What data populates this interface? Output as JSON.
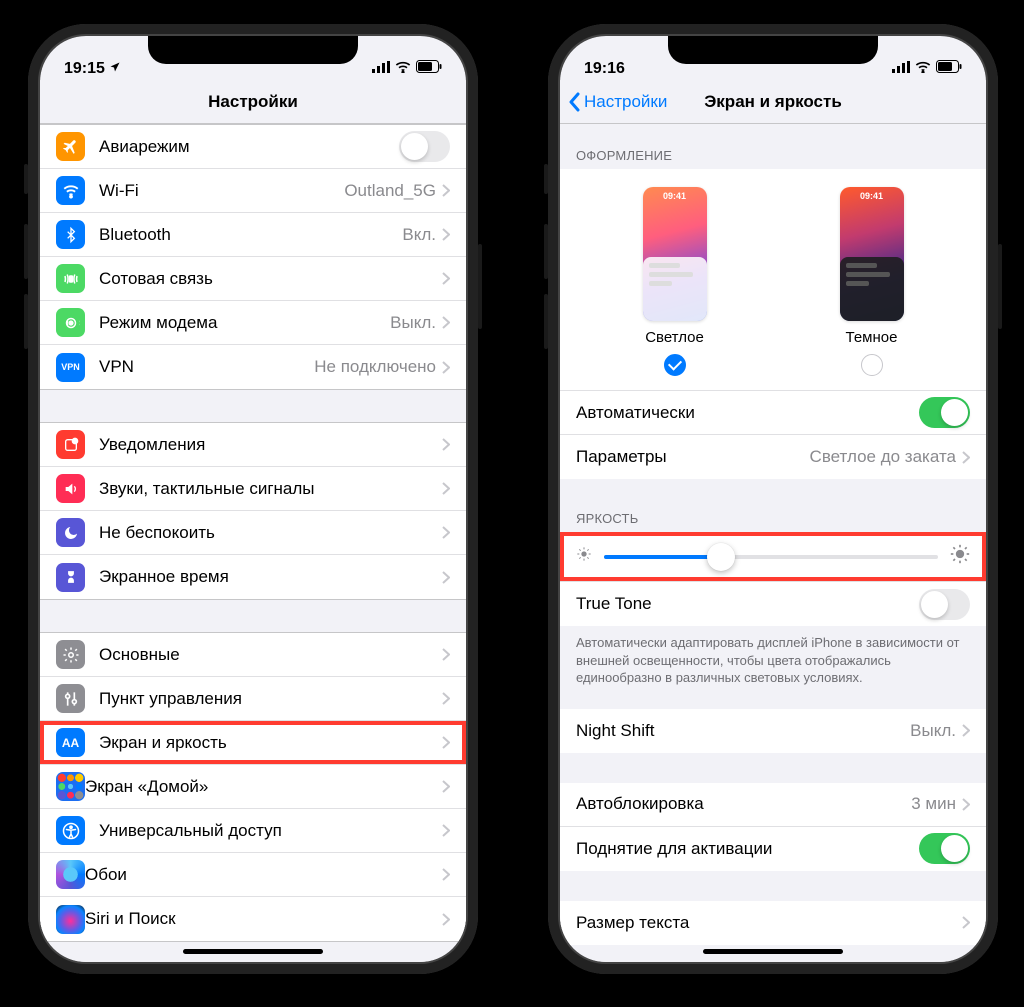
{
  "left": {
    "time": "19:15",
    "title": "Настройки",
    "groups": [
      [
        {
          "name": "airplane",
          "label": "Авиарежим",
          "icon_bg": "#ff9500",
          "toggle": false
        },
        {
          "name": "wifi",
          "label": "Wi-Fi",
          "value": "Outland_5G",
          "icon_bg": "#007aff"
        },
        {
          "name": "bluetooth",
          "label": "Bluetooth",
          "value": "Вкл.",
          "icon_bg": "#007aff"
        },
        {
          "name": "cellular",
          "label": "Сотовая связь",
          "icon_bg": "#4cd964"
        },
        {
          "name": "hotspot",
          "label": "Режим модема",
          "value": "Выкл.",
          "icon_bg": "#4cd964"
        },
        {
          "name": "vpn",
          "label": "VPN",
          "value": "Не подключено",
          "icon_bg": "#007aff",
          "icon_text": "VPN"
        }
      ],
      [
        {
          "name": "notifications",
          "label": "Уведомления",
          "icon_bg": "#ff3b30"
        },
        {
          "name": "sounds",
          "label": "Звуки, тактильные сигналы",
          "icon_bg": "#ff2d55"
        },
        {
          "name": "dnd",
          "label": "Не беспокоить",
          "icon_bg": "#5856d6"
        },
        {
          "name": "screentime",
          "label": "Экранное время",
          "icon_bg": "#5856d6"
        }
      ],
      [
        {
          "name": "general",
          "label": "Основные",
          "icon_bg": "#8e8e93"
        },
        {
          "name": "control-center",
          "label": "Пункт управления",
          "icon_bg": "#8e8e93"
        },
        {
          "name": "display",
          "label": "Экран и яркость",
          "icon_bg": "#007aff",
          "icon_text": "AA",
          "highlight": true
        },
        {
          "name": "home-screen",
          "label": "Экран «Домой»",
          "icon_bg": "#1c6ef2",
          "icon_kind": "grid"
        },
        {
          "name": "accessibility",
          "label": "Универсальный доступ",
          "icon_bg": "#007aff"
        },
        {
          "name": "wallpaper",
          "label": "Обои",
          "icon_bg": "#5ac8fa",
          "icon_kind": "wallpaper"
        },
        {
          "name": "siri",
          "label": "Siri и Поиск",
          "icon_bg": "#111",
          "icon_kind": "siri"
        }
      ]
    ]
  },
  "right": {
    "time": "19:16",
    "back": "Настройки",
    "title": "Экран и яркость",
    "section_appearance": "ОФОРМЛЕНИЕ",
    "appearance": {
      "preview_time": "09:41",
      "light_label": "Светлое",
      "dark_label": "Темное",
      "selected": "light"
    },
    "auto_label": "Автоматически",
    "auto_on": true,
    "params_label": "Параметры",
    "params_value": "Светлое до заката",
    "section_brightness": "ЯРКОСТЬ",
    "brightness_pct": 35,
    "truetone_label": "True Tone",
    "truetone_on": false,
    "truetone_note": "Автоматически адаптировать дисплей iPhone в зависимости от внешней освещенности, чтобы цвета отображались единообразно в различных световых условиях.",
    "nightshift_label": "Night Shift",
    "nightshift_value": "Выкл.",
    "autolock_label": "Автоблокировка",
    "autolock_value": "3 мин",
    "raise_label": "Поднятие для активации",
    "raise_on": true,
    "textsize_label": "Размер текста"
  }
}
